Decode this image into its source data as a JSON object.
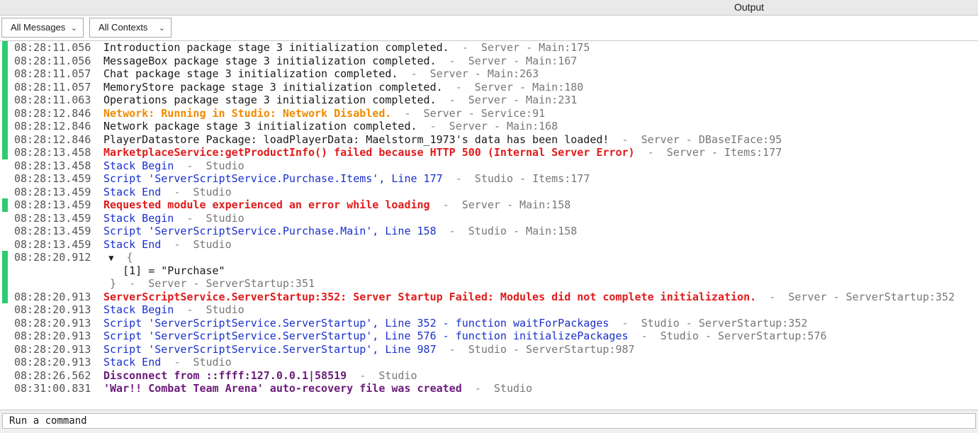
{
  "window": {
    "title": "Output"
  },
  "filters": {
    "messages_label": "All Messages",
    "contexts_label": "All Contexts"
  },
  "log": [
    {
      "time": "08:28:11.056",
      "text": "Introduction package stage 3 initialization completed.",
      "source": "Server - Main:175",
      "level": "info",
      "marker": true
    },
    {
      "time": "08:28:11.056",
      "text": "MessageBox package stage 3 initialization completed.",
      "source": "Server - Main:167",
      "level": "info",
      "marker": true
    },
    {
      "time": "08:28:11.057",
      "text": "Chat package stage 3 initialization completed.",
      "source": "Server - Main:263",
      "level": "info",
      "marker": true
    },
    {
      "time": "08:28:11.057",
      "text": "MemoryStore package stage 3 initialization completed.",
      "source": "Server - Main:180",
      "level": "info",
      "marker": true
    },
    {
      "time": "08:28:11.063",
      "text": "Operations package stage 3 initialization completed.",
      "source": "Server - Main:231",
      "level": "info",
      "marker": true
    },
    {
      "time": "08:28:12.846",
      "text": "Network: Running in Studio: Network Disabled.",
      "source": "Server - Service:91",
      "level": "warn",
      "marker": true
    },
    {
      "time": "08:28:12.846",
      "text": "Network package stage 3 initialization completed.",
      "source": "Server - Main:168",
      "level": "info",
      "marker": true
    },
    {
      "time": "08:28:12.846",
      "text": "PlayerDatastore Package: loadPlayerData: Maelstorm_1973's data has been loaded!",
      "source": "Server - DBaseIFace:95",
      "level": "info",
      "marker": true
    },
    {
      "time": "08:28:13.458",
      "text": "MarketplaceService:getProductInfo() failed because HTTP 500 (Internal Server Error)",
      "source": "Server - Items:177",
      "level": "err",
      "marker": true
    },
    {
      "time": "08:28:13.458",
      "text": "Stack Begin",
      "source": "Studio",
      "level": "stack",
      "marker": false
    },
    {
      "time": "08:28:13.459",
      "text": "Script 'ServerScriptService.Purchase.Items', Line 177",
      "source": "Studio - Items:177",
      "level": "stack",
      "marker": false
    },
    {
      "time": "08:28:13.459",
      "text": "Stack End",
      "source": "Studio",
      "level": "stack",
      "marker": false
    },
    {
      "time": "08:28:13.459",
      "text": "Requested module experienced an error while loading",
      "source": "Server - Main:158",
      "level": "err",
      "marker": true
    },
    {
      "time": "08:28:13.459",
      "text": "Stack Begin",
      "source": "Studio",
      "level": "stack",
      "marker": false
    },
    {
      "time": "08:28:13.459",
      "text": "Script 'ServerScriptService.Purchase.Main', Line 158",
      "source": "Studio - Main:158",
      "level": "stack",
      "marker": false
    },
    {
      "time": "08:28:13.459",
      "text": "Stack End",
      "source": "Studio",
      "level": "stack",
      "marker": false
    }
  ],
  "table_entry": {
    "time": "08:28:20.912",
    "toggle": "▼",
    "open_brace": "{",
    "item": "[1] = \"Purchase\"",
    "close_brace": "}",
    "source": "Server - ServerStartup:351"
  },
  "log2": [
    {
      "time": "08:28:20.913",
      "text": "ServerScriptService.ServerStartup:352: Server Startup Failed: Modules did not complete initialization.",
      "source": "Server - ServerStartup:352",
      "level": "err",
      "marker": true
    },
    {
      "time": "08:28:20.913",
      "text": "Stack Begin",
      "source": "Studio",
      "level": "stack",
      "marker": false
    },
    {
      "time": "08:28:20.913",
      "text": "Script 'ServerScriptService.ServerStartup', Line 352 - function waitForPackages",
      "source": "Studio - ServerStartup:352",
      "level": "stack",
      "marker": false
    },
    {
      "time": "08:28:20.913",
      "text": "Script 'ServerScriptService.ServerStartup', Line 576 - function initializePackages",
      "source": "Studio - ServerStartup:576",
      "level": "stack",
      "marker": false
    },
    {
      "time": "08:28:20.913",
      "text": "Script 'ServerScriptService.ServerStartup', Line 987",
      "source": "Studio - ServerStartup:987",
      "level": "stack",
      "marker": false
    },
    {
      "time": "08:28:20.913",
      "text": "Stack End",
      "source": "Studio",
      "level": "stack",
      "marker": false
    },
    {
      "time": "08:28:26.562",
      "text": "Disconnect from ::ffff:127.0.0.1|58519",
      "source": "Studio",
      "level": "purple",
      "marker": false
    },
    {
      "time": "08:31:00.831",
      "text": "'War!! Combat Team Arena' auto-recovery file was created",
      "source": "Studio",
      "level": "purple",
      "marker": false
    }
  ],
  "separator": "-",
  "command": {
    "placeholder": "Run a command"
  },
  "colors": {
    "marker": "#2ecc71",
    "warning": "#f08a00",
    "error": "#e01b1b",
    "stack": "#1930cc",
    "studio_purple": "#6b1a7a"
  },
  "icons": {
    "dropdown": "chevron-down-icon",
    "expand": "triangle-down-icon"
  }
}
